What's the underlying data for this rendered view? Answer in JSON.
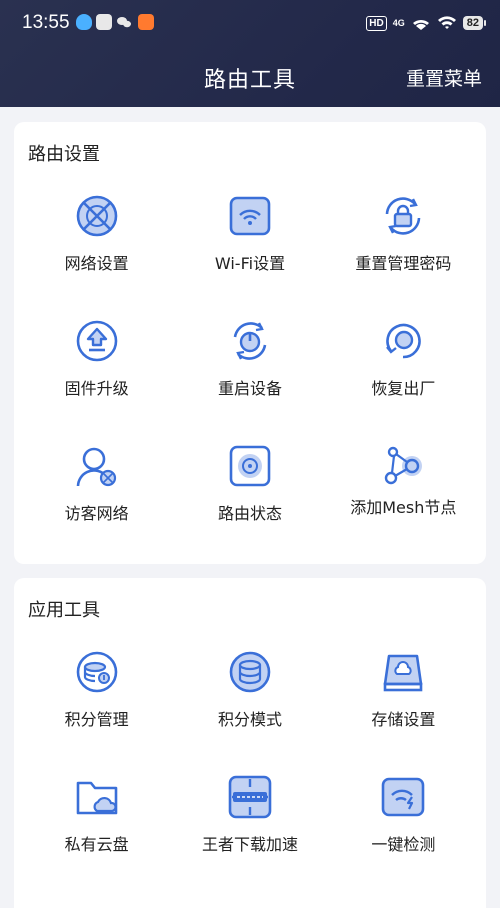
{
  "status_bar": {
    "time": "13:55",
    "hd": "HD",
    "network": "4G",
    "battery": "82"
  },
  "header": {
    "title": "路由工具",
    "reset_menu": "重置菜单"
  },
  "router_settings": {
    "title": "路由设置",
    "items": [
      {
        "label": "网络设置",
        "icon": "network-globe-icon"
      },
      {
        "label": "Wi-Fi设置",
        "icon": "wifi-router-icon"
      },
      {
        "label": "重置管理密码",
        "icon": "lock-refresh-icon"
      },
      {
        "label": "固件升级",
        "icon": "firmware-upgrade-icon"
      },
      {
        "label": "重启设备",
        "icon": "restart-power-icon"
      },
      {
        "label": "恢复出厂",
        "icon": "factory-reset-icon"
      },
      {
        "label": "访客网络",
        "icon": "guest-user-icon"
      },
      {
        "label": "路由状态",
        "icon": "router-status-icon"
      },
      {
        "label": "添加Mesh节点",
        "icon": "mesh-node-icon"
      }
    ]
  },
  "app_tools": {
    "title": "应用工具",
    "items": [
      {
        "label": "积分管理",
        "icon": "points-management-icon"
      },
      {
        "label": "积分模式",
        "icon": "points-mode-icon"
      },
      {
        "label": "存储设置",
        "icon": "storage-cloud-icon"
      },
      {
        "label": "私有云盘",
        "icon": "private-cloud-folder-icon"
      },
      {
        "label": "王者下载加速",
        "icon": "game-download-boost-icon"
      },
      {
        "label": "一键检测",
        "icon": "one-click-check-icon"
      }
    ]
  },
  "colors": {
    "header_bg": "#252b4b",
    "accent_blue": "#3a6fd8",
    "light_blue": "#b7c9ef"
  }
}
